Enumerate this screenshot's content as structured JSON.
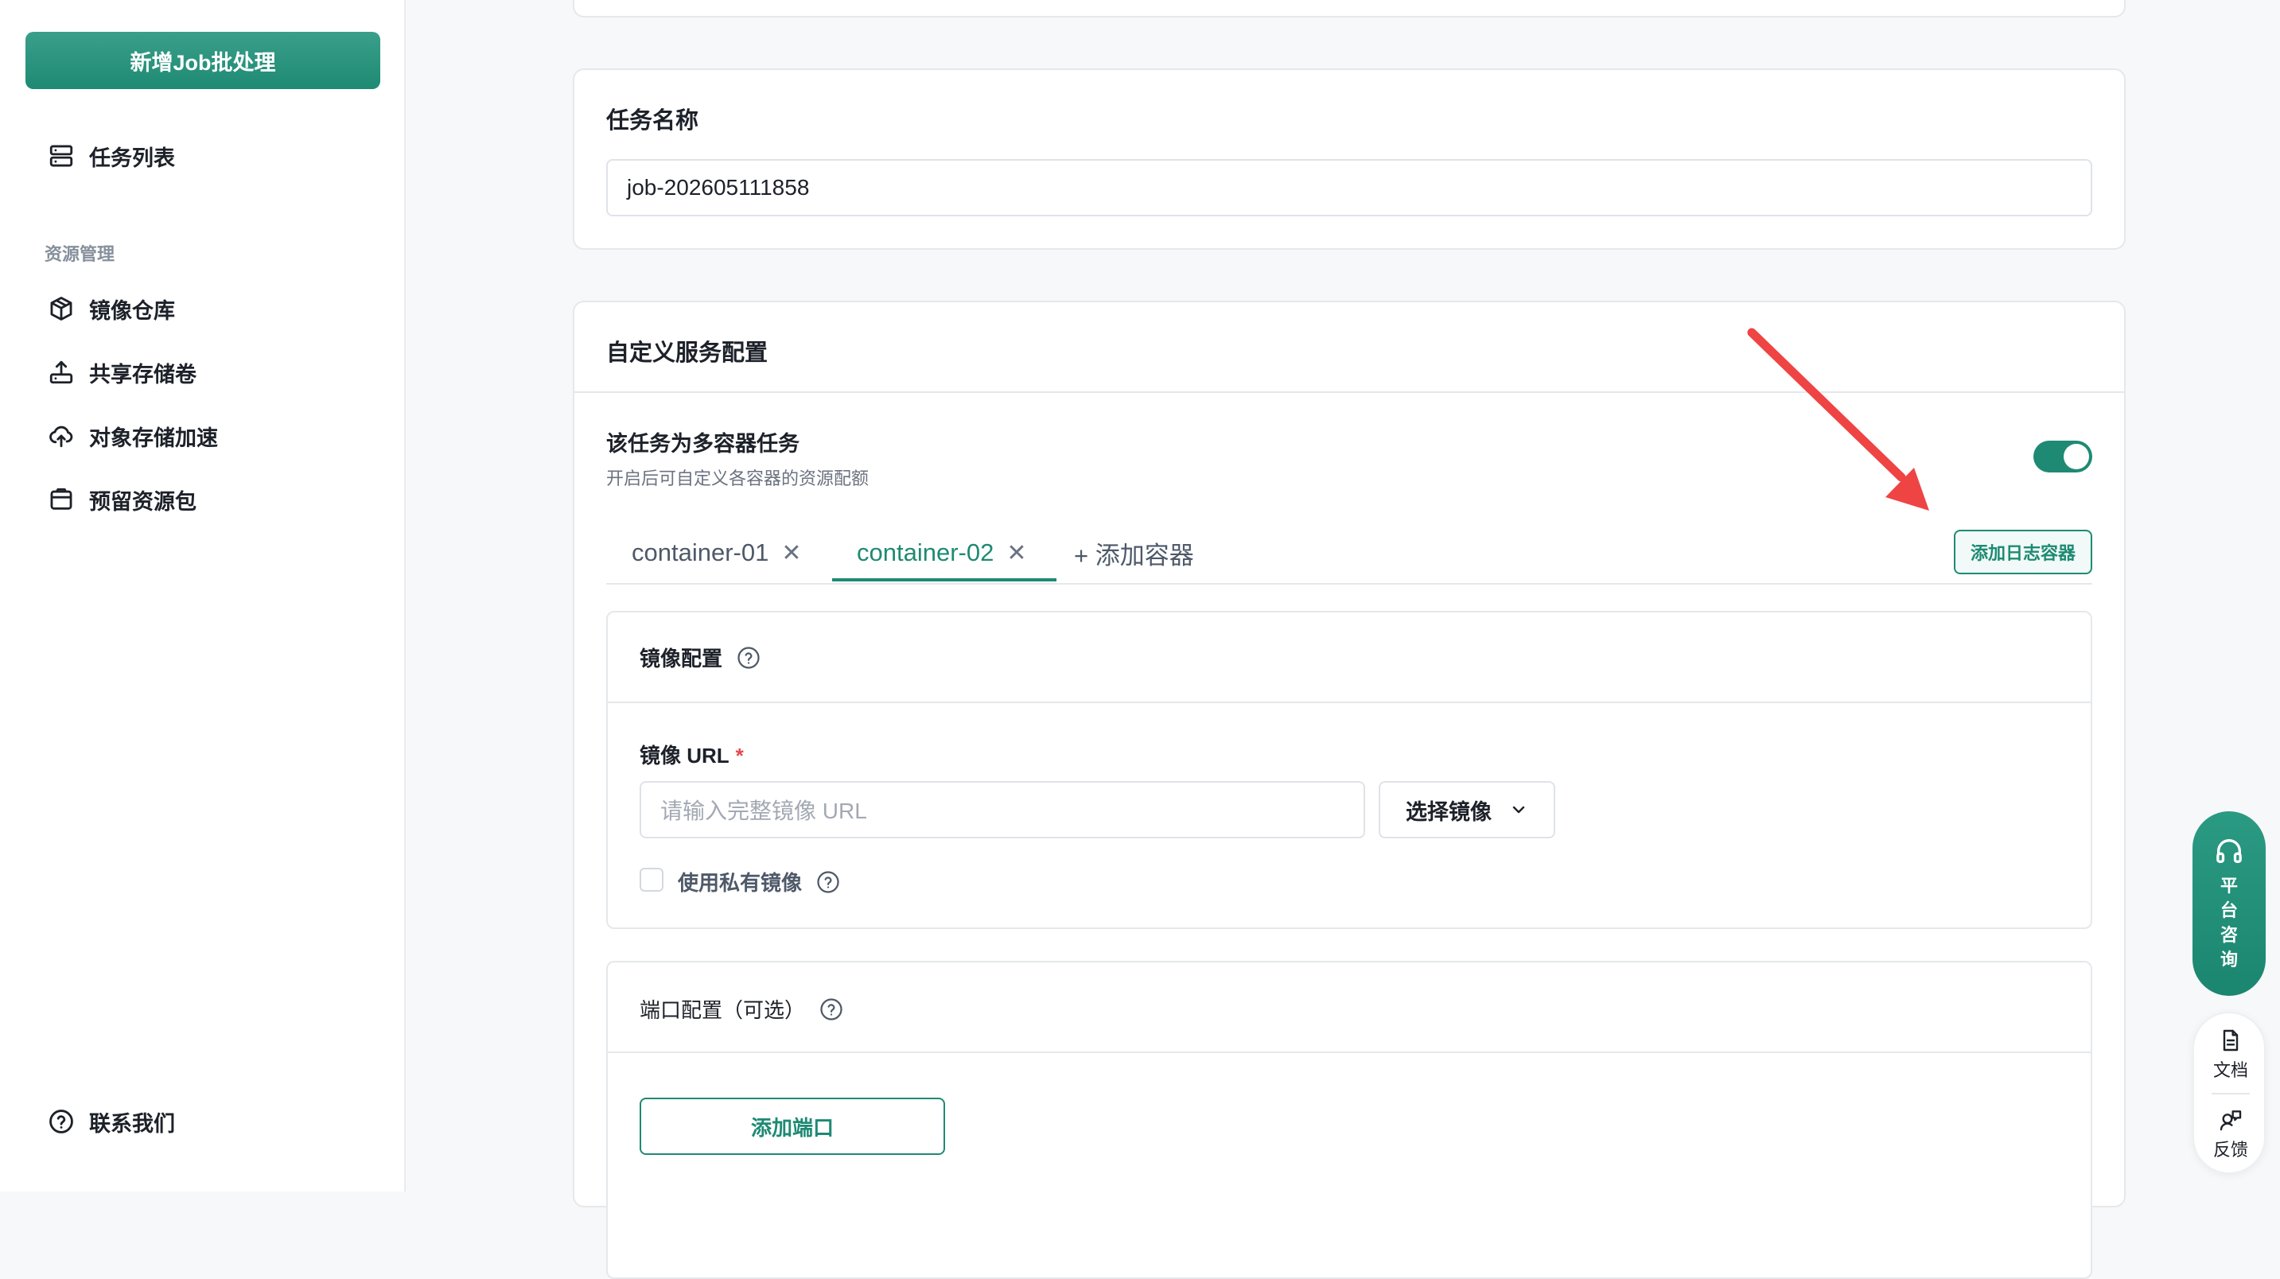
{
  "sidebar": {
    "new_job_button": "新增Job批处理",
    "task_list": "任务列表",
    "section_resource": "资源管理",
    "items": [
      {
        "label": "镜像仓库",
        "icon": "box-icon"
      },
      {
        "label": "共享存储卷",
        "icon": "upload-tray-icon"
      },
      {
        "label": "对象存储加速",
        "icon": "cloud-upload-icon"
      },
      {
        "label": "预留资源包",
        "icon": "package-icon"
      }
    ],
    "contact": "联系我们"
  },
  "task_name_card": {
    "title": "任务名称",
    "value": "job-202605111858"
  },
  "custom_service_card": {
    "title": "自定义服务配置",
    "multi_container": {
      "label": "该任务为多容器任务",
      "description": "开启后可自定义各容器的资源配额",
      "enabled": true
    },
    "tabs": [
      {
        "label": "container-01",
        "active": false
      },
      {
        "label": "container-02",
        "active": true
      }
    ],
    "add_container": "+ 添加容器",
    "add_log_container": "添加日志容器",
    "image_config": {
      "title": "镜像配置",
      "url_label": "镜像 URL",
      "required_mark": "*",
      "url_placeholder": "请输入完整镜像 URL",
      "select_image": "选择镜像",
      "use_private": "使用私有镜像"
    },
    "port_config": {
      "title": "端口配置（可选）",
      "add_port": "添加端口"
    }
  },
  "floating": {
    "consult_chars": [
      "平",
      "台",
      "咨",
      "询"
    ],
    "docs": "文档",
    "feedback": "反馈"
  },
  "colors": {
    "accent": "#1e8a73",
    "arrow": "#ef4444"
  }
}
